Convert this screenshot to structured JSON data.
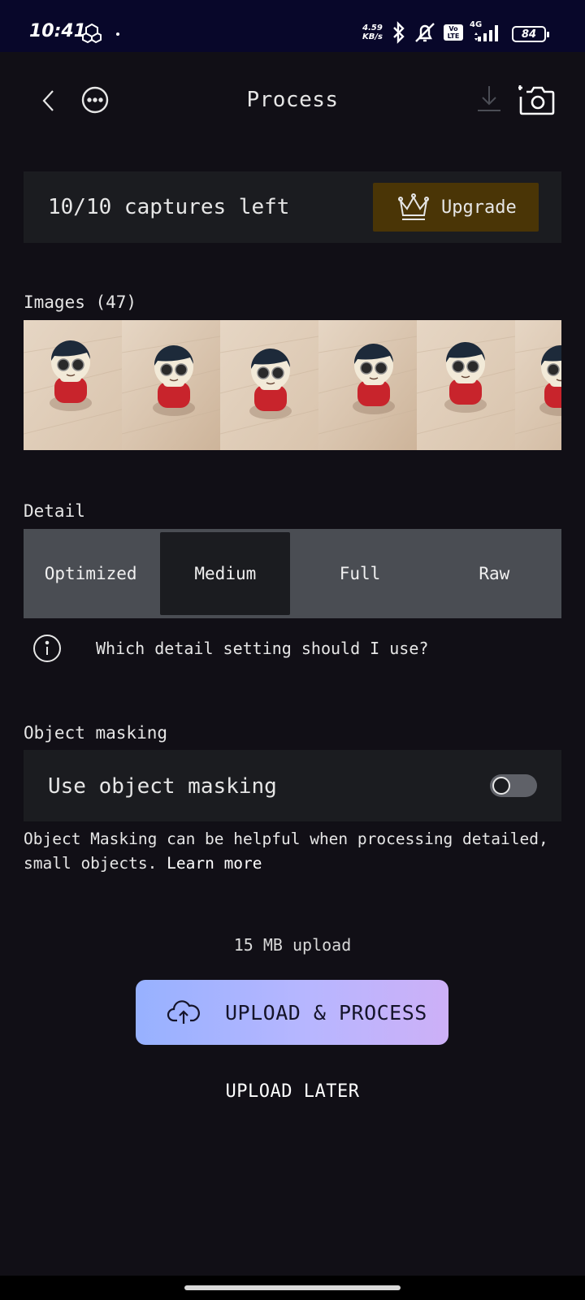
{
  "status_bar": {
    "time": "10:41",
    "net_speed_value": "4.59",
    "net_speed_unit": "KB/s",
    "lte_badge": "Vo LTE",
    "network": "4G",
    "battery": "84",
    "icons": [
      "cube-app-icon",
      "bluetooth-icon",
      "mute-icon",
      "volte-icon",
      "signal-icon",
      "battery-icon"
    ]
  },
  "header": {
    "title": "Process",
    "back_icon": "chevron-left-icon",
    "more_icon": "more-horizontal-icon",
    "download_icon": "download-icon",
    "camera_icon": "add-camera-icon"
  },
  "captures": {
    "text": "10/10 captures left",
    "upgrade_label": "Upgrade",
    "upgrade_icon": "crown-icon",
    "upgrade_color": "#4a3506"
  },
  "images": {
    "label": "Images (47)",
    "thumbnails": [
      "figurine photo 1",
      "figurine photo 2",
      "figurine photo 3",
      "figurine photo 4",
      "figurine photo 5",
      "figurine photo 6"
    ]
  },
  "detail": {
    "label": "Detail",
    "options": [
      "Optimized",
      "Medium",
      "Full",
      "Raw"
    ],
    "selected": "Medium",
    "help_text": "Which detail setting should I use?"
  },
  "object_masking": {
    "label": "Object masking",
    "toggle_label": "Use object masking",
    "enabled": false,
    "description": "Object Masking can be helpful when processing detailed, small objects.",
    "learn_more": "Learn more"
  },
  "upload": {
    "size_text": "15 MB upload",
    "primary_label": "UPLOAD & PROCESS",
    "primary_icon": "cloud-upload-icon",
    "secondary_label": "UPLOAD LATER",
    "gradient_start": "#97b1ff",
    "gradient_end": "#cdb0f7"
  }
}
